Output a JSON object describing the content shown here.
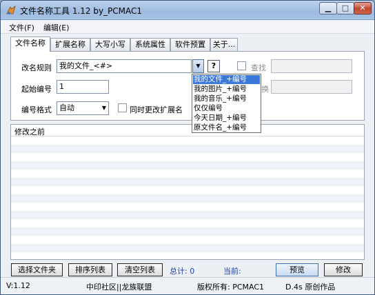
{
  "window": {
    "title": "文件名称工具 1.12  by_PCMAC1",
    "min_label": "▁",
    "max_label": "□",
    "close_label": "✕"
  },
  "menu": [
    "文件(F)",
    "编辑(E)"
  ],
  "tabs": [
    "文件名称",
    "扩展名称",
    "大写小写",
    "系统属性",
    "软件预置",
    "关于..."
  ],
  "form": {
    "rule_label": "改名规则",
    "rule_value": "我的文件_<#>",
    "help_label": "?",
    "find_label": "查找",
    "replace_label": "换",
    "start_label": "起始编号",
    "start_value": "1",
    "format_label": "编号格式",
    "format_value": "自动",
    "also_ext_label": "同时更改扩展名"
  },
  "dropdown_items": [
    "我的文件_+编号",
    "我的图片_+编号",
    "我的音乐_+编号",
    "仅仅编号",
    "今天日期_+编号",
    "原文件名_+编号"
  ],
  "list": {
    "header": "修改之前"
  },
  "buttons": {
    "select_folder": "选择文件夹",
    "sort_list": "排序列表",
    "clear_list": "清空列表",
    "preview": "预览",
    "modify": "修改"
  },
  "info": {
    "total": "总计: 0",
    "current": "当前:"
  },
  "status": [
    "V:1.12",
    "中印社区||龙族联盟",
    "版权所有: PCMAC1",
    "D.4s 原创作品"
  ],
  "colors": {
    "titlebar": "#a8c4e6",
    "selection": "#3b78d9",
    "close": "#c0462e"
  }
}
